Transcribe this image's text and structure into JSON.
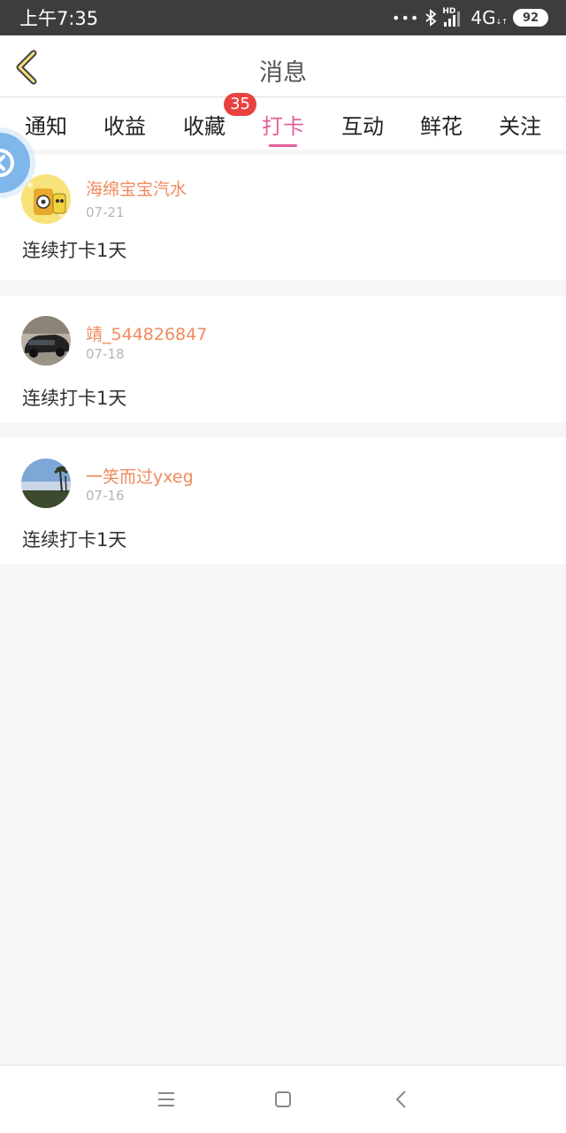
{
  "status_bar": {
    "time": "上午7:35",
    "signal_label": "HD",
    "network": "4G",
    "battery": "92"
  },
  "header": {
    "title": "消息"
  },
  "tabs": [
    {
      "label": "通知",
      "active": false
    },
    {
      "label": "收益",
      "active": false
    },
    {
      "label": "收藏",
      "active": false,
      "badge": "35"
    },
    {
      "label": "打卡",
      "active": true
    },
    {
      "label": "互动",
      "active": false
    },
    {
      "label": "鲜花",
      "active": false
    },
    {
      "label": "关注",
      "active": false
    }
  ],
  "messages": [
    {
      "username": "海绵宝宝汽水",
      "date": "07-21",
      "text": "连续打卡1天"
    },
    {
      "username": "靖_544826847",
      "date": "07-18",
      "text": "连续打卡1天"
    },
    {
      "username": "一笑而过yxeg",
      "date": "07-16",
      "text": "连续打卡1天"
    }
  ],
  "colors": {
    "accent": "#e3609b",
    "username": "#f08a5d",
    "badge": "#e94141",
    "status_bar": "#3d3d3d"
  }
}
